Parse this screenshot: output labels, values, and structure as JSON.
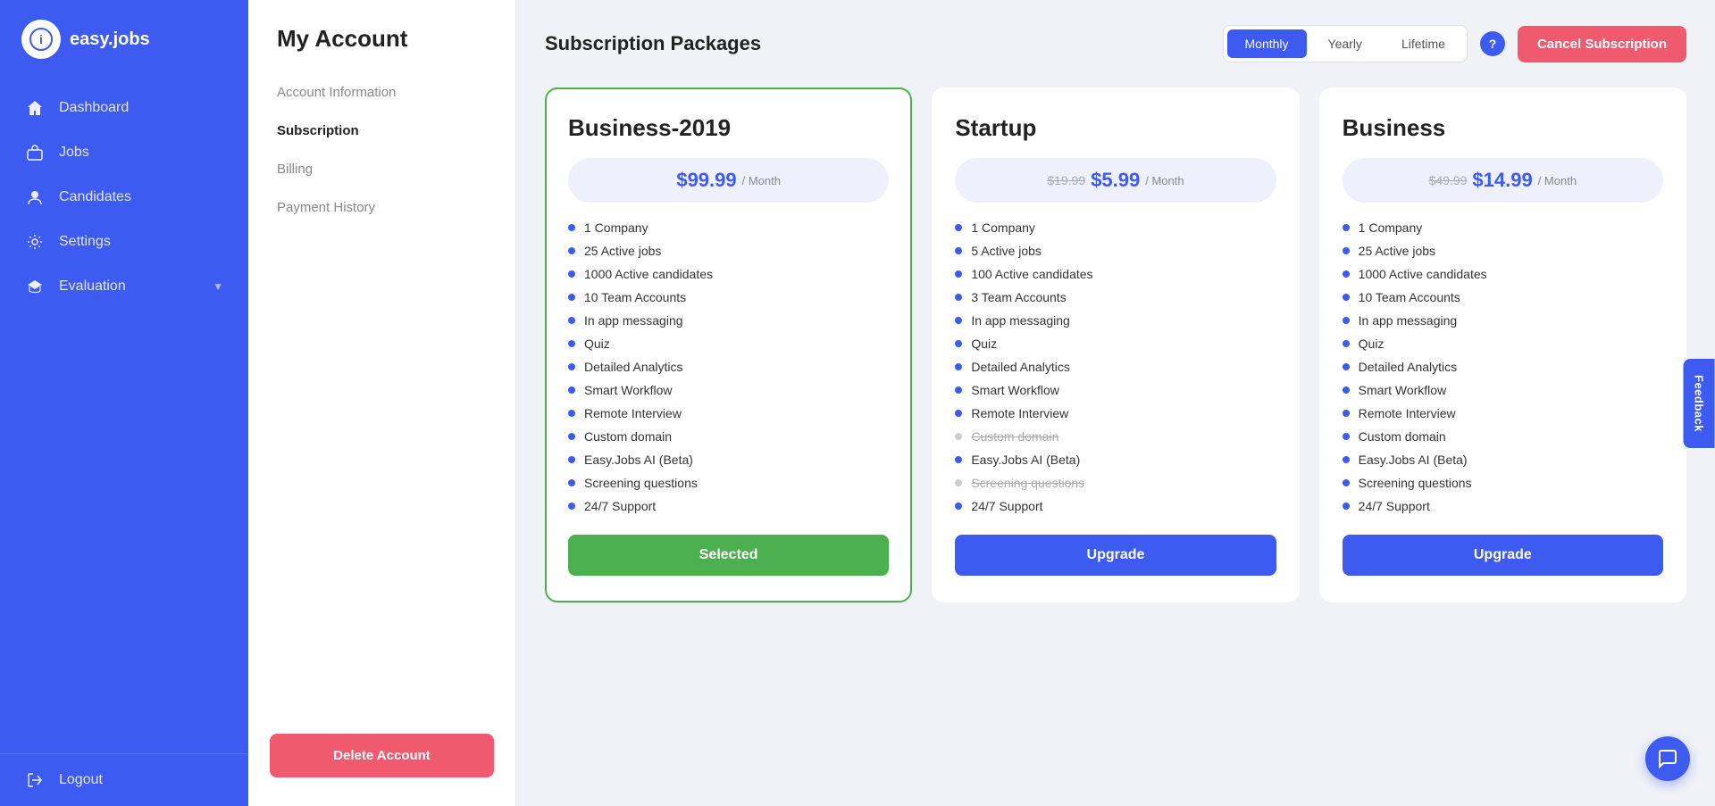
{
  "sidebar": {
    "logo_text": "easy.jobs",
    "logo_icon": "i",
    "nav_items": [
      {
        "id": "dashboard",
        "label": "Dashboard",
        "icon": "home"
      },
      {
        "id": "jobs",
        "label": "Jobs",
        "icon": "briefcase"
      },
      {
        "id": "candidates",
        "label": "Candidates",
        "icon": "user"
      },
      {
        "id": "settings",
        "label": "Settings",
        "icon": "gear"
      },
      {
        "id": "evaluation",
        "label": "Evaluation",
        "icon": "graduation",
        "has_chevron": true
      }
    ],
    "logout_label": "Logout"
  },
  "left_panel": {
    "title": "My Account",
    "menu_items": [
      {
        "id": "account-info",
        "label": "Account Information",
        "active": false
      },
      {
        "id": "subscription",
        "label": "Subscription",
        "active": true
      },
      {
        "id": "billing",
        "label": "Billing",
        "active": false
      },
      {
        "id": "payment-history",
        "label": "Payment History",
        "active": false
      }
    ],
    "delete_account_label": "Delete Account"
  },
  "subscription": {
    "title": "Subscription Packages",
    "billing_toggle": {
      "options": [
        {
          "id": "monthly",
          "label": "Monthly",
          "active": true
        },
        {
          "id": "yearly",
          "label": "Yearly",
          "active": false
        },
        {
          "id": "lifetime",
          "label": "Lifetime",
          "active": false
        }
      ]
    },
    "cancel_subscription_label": "Cancel Subscription",
    "help_icon": "?",
    "plans": [
      {
        "id": "business-2019",
        "name": "Business-2019",
        "price_original": null,
        "price_current": "$99.99",
        "price_period": "/ Month",
        "is_selected": true,
        "action_label": "Selected",
        "features": [
          {
            "text": "1 Company",
            "active": true,
            "strikethrough": false
          },
          {
            "text": "25 Active jobs",
            "active": true,
            "strikethrough": false
          },
          {
            "text": "1000 Active candidates",
            "active": true,
            "strikethrough": false
          },
          {
            "text": "10 Team Accounts",
            "active": true,
            "strikethrough": false
          },
          {
            "text": "In app messaging",
            "active": true,
            "strikethrough": false
          },
          {
            "text": "Quiz",
            "active": true,
            "strikethrough": false
          },
          {
            "text": "Detailed Analytics",
            "active": true,
            "strikethrough": false
          },
          {
            "text": "Smart Workflow",
            "active": true,
            "strikethrough": false
          },
          {
            "text": "Remote Interview",
            "active": true,
            "strikethrough": false
          },
          {
            "text": "Custom domain",
            "active": true,
            "strikethrough": false
          },
          {
            "text": "Easy.Jobs AI (Beta)",
            "active": true,
            "strikethrough": false
          },
          {
            "text": "Screening questions",
            "active": true,
            "strikethrough": false
          },
          {
            "text": "24/7 Support",
            "active": true,
            "strikethrough": false
          }
        ]
      },
      {
        "id": "startup",
        "name": "Startup",
        "price_original": "$19.99",
        "price_current": "$5.99",
        "price_period": "/ Month",
        "is_selected": false,
        "action_label": "Upgrade",
        "features": [
          {
            "text": "1 Company",
            "active": true,
            "strikethrough": false
          },
          {
            "text": "5 Active jobs",
            "active": true,
            "strikethrough": false
          },
          {
            "text": "100 Active candidates",
            "active": true,
            "strikethrough": false
          },
          {
            "text": "3 Team Accounts",
            "active": true,
            "strikethrough": false
          },
          {
            "text": "In app messaging",
            "active": true,
            "strikethrough": false
          },
          {
            "text": "Quiz",
            "active": true,
            "strikethrough": false
          },
          {
            "text": "Detailed Analytics",
            "active": true,
            "strikethrough": false
          },
          {
            "text": "Smart Workflow",
            "active": true,
            "strikethrough": false
          },
          {
            "text": "Remote Interview",
            "active": true,
            "strikethrough": false
          },
          {
            "text": "Custom domain",
            "active": false,
            "strikethrough": true
          },
          {
            "text": "Easy.Jobs AI (Beta)",
            "active": true,
            "strikethrough": false
          },
          {
            "text": "Screening questions",
            "active": false,
            "strikethrough": true
          },
          {
            "text": "24/7 Support",
            "active": true,
            "strikethrough": false
          }
        ]
      },
      {
        "id": "business",
        "name": "Business",
        "price_original": "$49.99",
        "price_current": "$14.99",
        "price_period": "/ Month",
        "is_selected": false,
        "action_label": "Upgrade",
        "features": [
          {
            "text": "1 Company",
            "active": true,
            "strikethrough": false
          },
          {
            "text": "25 Active jobs",
            "active": true,
            "strikethrough": false
          },
          {
            "text": "1000 Active candidates",
            "active": true,
            "strikethrough": false
          },
          {
            "text": "10 Team Accounts",
            "active": true,
            "strikethrough": false
          },
          {
            "text": "In app messaging",
            "active": true,
            "strikethrough": false
          },
          {
            "text": "Quiz",
            "active": true,
            "strikethrough": false
          },
          {
            "text": "Detailed Analytics",
            "active": true,
            "strikethrough": false
          },
          {
            "text": "Smart Workflow",
            "active": true,
            "strikethrough": false
          },
          {
            "text": "Remote Interview",
            "active": true,
            "strikethrough": false
          },
          {
            "text": "Custom domain",
            "active": true,
            "strikethrough": false
          },
          {
            "text": "Easy.Jobs AI (Beta)",
            "active": true,
            "strikethrough": false
          },
          {
            "text": "Screening questions",
            "active": true,
            "strikethrough": false
          },
          {
            "text": "24/7 Support",
            "active": true,
            "strikethrough": false
          }
        ]
      }
    ]
  },
  "feedback_label": "Feedback"
}
